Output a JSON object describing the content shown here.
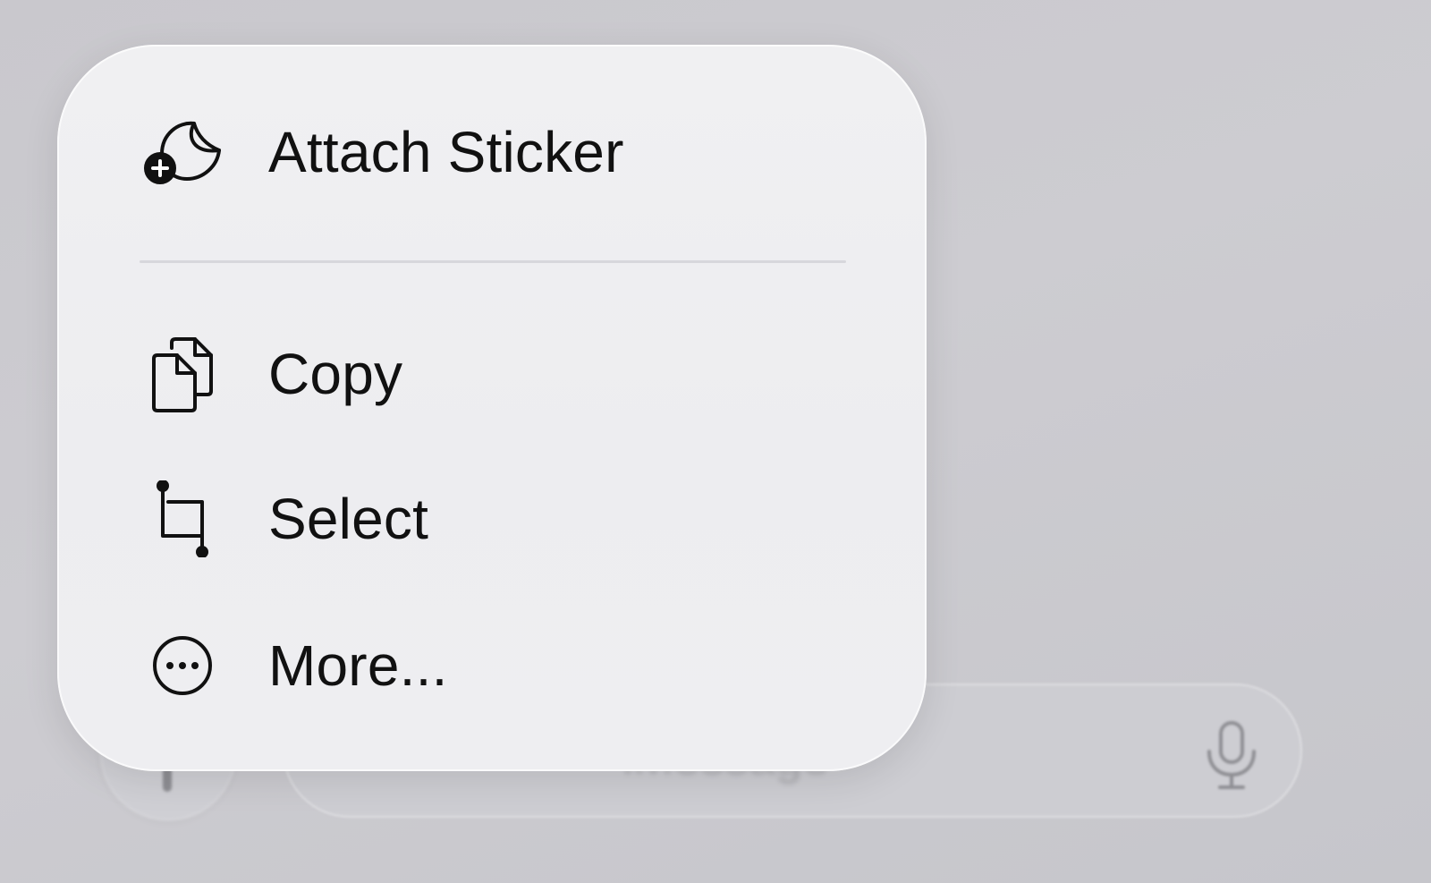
{
  "background": {
    "composer": {
      "placeholder": "iMessage",
      "mic_icon": "microphone-icon",
      "plus_icon": "plus-icon"
    }
  },
  "context_menu": {
    "items": [
      {
        "label": "Attach Sticker",
        "icon": "sticker-add-icon"
      },
      {
        "label": "Copy",
        "icon": "copy-documents-icon"
      },
      {
        "label": "Select",
        "icon": "crop-select-icon"
      },
      {
        "label": "More...",
        "icon": "ellipsis-circle-icon"
      }
    ]
  },
  "colors": {
    "menu_background": "#efeff1",
    "text": "#111111",
    "page_background": "#c9c8cd",
    "divider": "#d7d7dc"
  }
}
